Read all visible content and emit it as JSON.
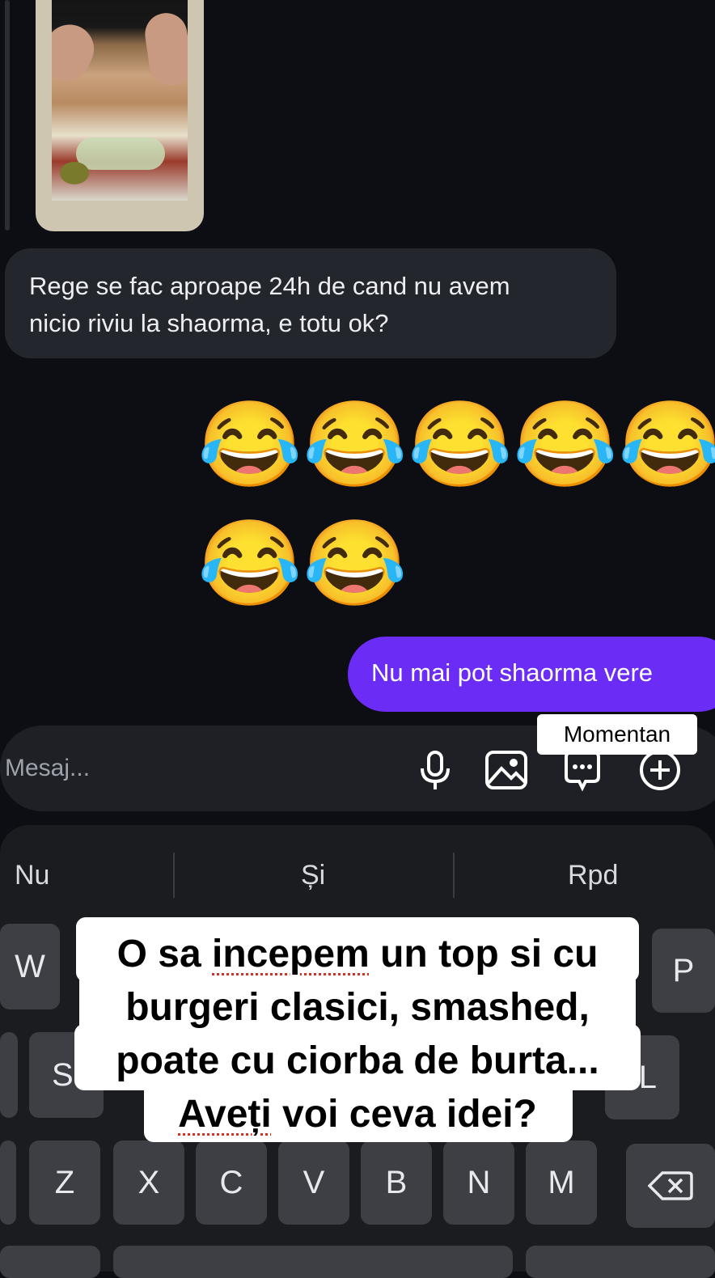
{
  "thread": {
    "received_message": "Rege se fac aproape 24h de cand nu avem\nnicio riviu la shaorma, e totu ok?",
    "emoji_reaction": [
      "😂",
      "😂",
      "😂",
      "😂",
      "😂",
      "😂",
      "😂"
    ],
    "sent_message": "Nu mai pot shaorma vere",
    "sent_status_tooltip": "Momentan"
  },
  "composer": {
    "placeholder": "Mesaj...",
    "icons": [
      "microphone-icon",
      "gallery-icon",
      "sticker-chat-icon",
      "plus-circle-icon"
    ]
  },
  "keyboard": {
    "suggestions": [
      "Nu",
      "Și",
      "Rpd"
    ],
    "keys": {
      "row1_visible": [
        "W",
        "P"
      ],
      "row2_visible": [
        "S",
        "L"
      ],
      "row3": [
        "Z",
        "X",
        "C",
        "V",
        "B",
        "N",
        "M"
      ],
      "backspace_icon": "backspace-icon"
    }
  },
  "caption": {
    "line1_pre": "O sa ",
    "line1_squiggle": "incepem",
    "line1_post": " un top si cu",
    "line2": "burgeri clasici, smashed,",
    "line3": "poate cu ciorba de burta...",
    "line4_squiggle": "Aveți",
    "line4_post": " voi ceva idei?"
  },
  "colors": {
    "background": "#0c0e13",
    "received_bubble": "#24262d",
    "sent_bubble": "#6b2cf5",
    "keyboard": "#1b1c20",
    "key": "#3d3f45"
  }
}
